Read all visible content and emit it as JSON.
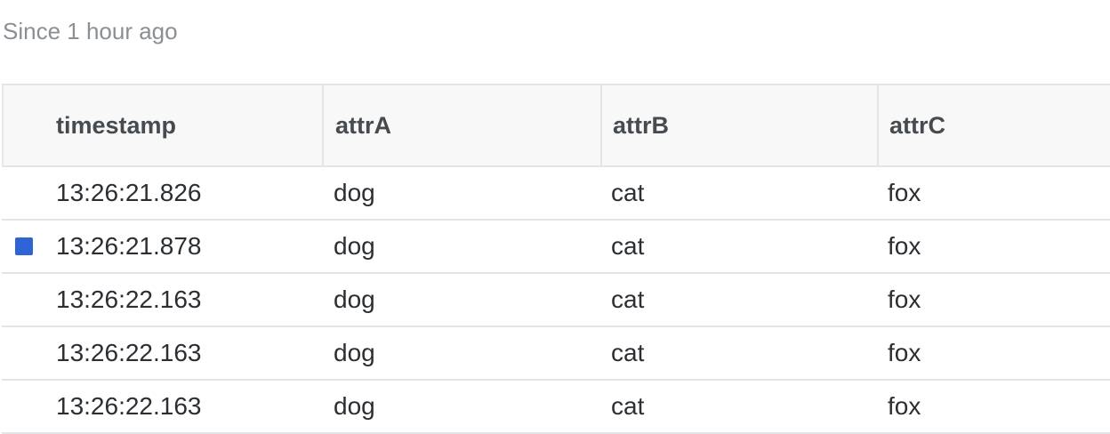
{
  "subtitle": "Since 1 hour ago",
  "colors": {
    "series_marker": "#2f64d6",
    "header_bg": "#f8f8f8",
    "border": "#e2e4e6"
  },
  "table": {
    "columns": [
      "timestamp",
      "attrA",
      "attrB",
      "attrC"
    ],
    "rows": [
      {
        "timestamp": "13:26:21.826",
        "attrA": "dog",
        "attrB": "cat",
        "attrC": "fox",
        "marked": false
      },
      {
        "timestamp": "13:26:21.878",
        "attrA": "dog",
        "attrB": "cat",
        "attrC": "fox",
        "marked": true
      },
      {
        "timestamp": "13:26:22.163",
        "attrA": "dog",
        "attrB": "cat",
        "attrC": "fox",
        "marked": false
      },
      {
        "timestamp": "13:26:22.163",
        "attrA": "dog",
        "attrB": "cat",
        "attrC": "fox",
        "marked": false
      },
      {
        "timestamp": "13:26:22.163",
        "attrA": "dog",
        "attrB": "cat",
        "attrC": "fox",
        "marked": false
      }
    ]
  }
}
